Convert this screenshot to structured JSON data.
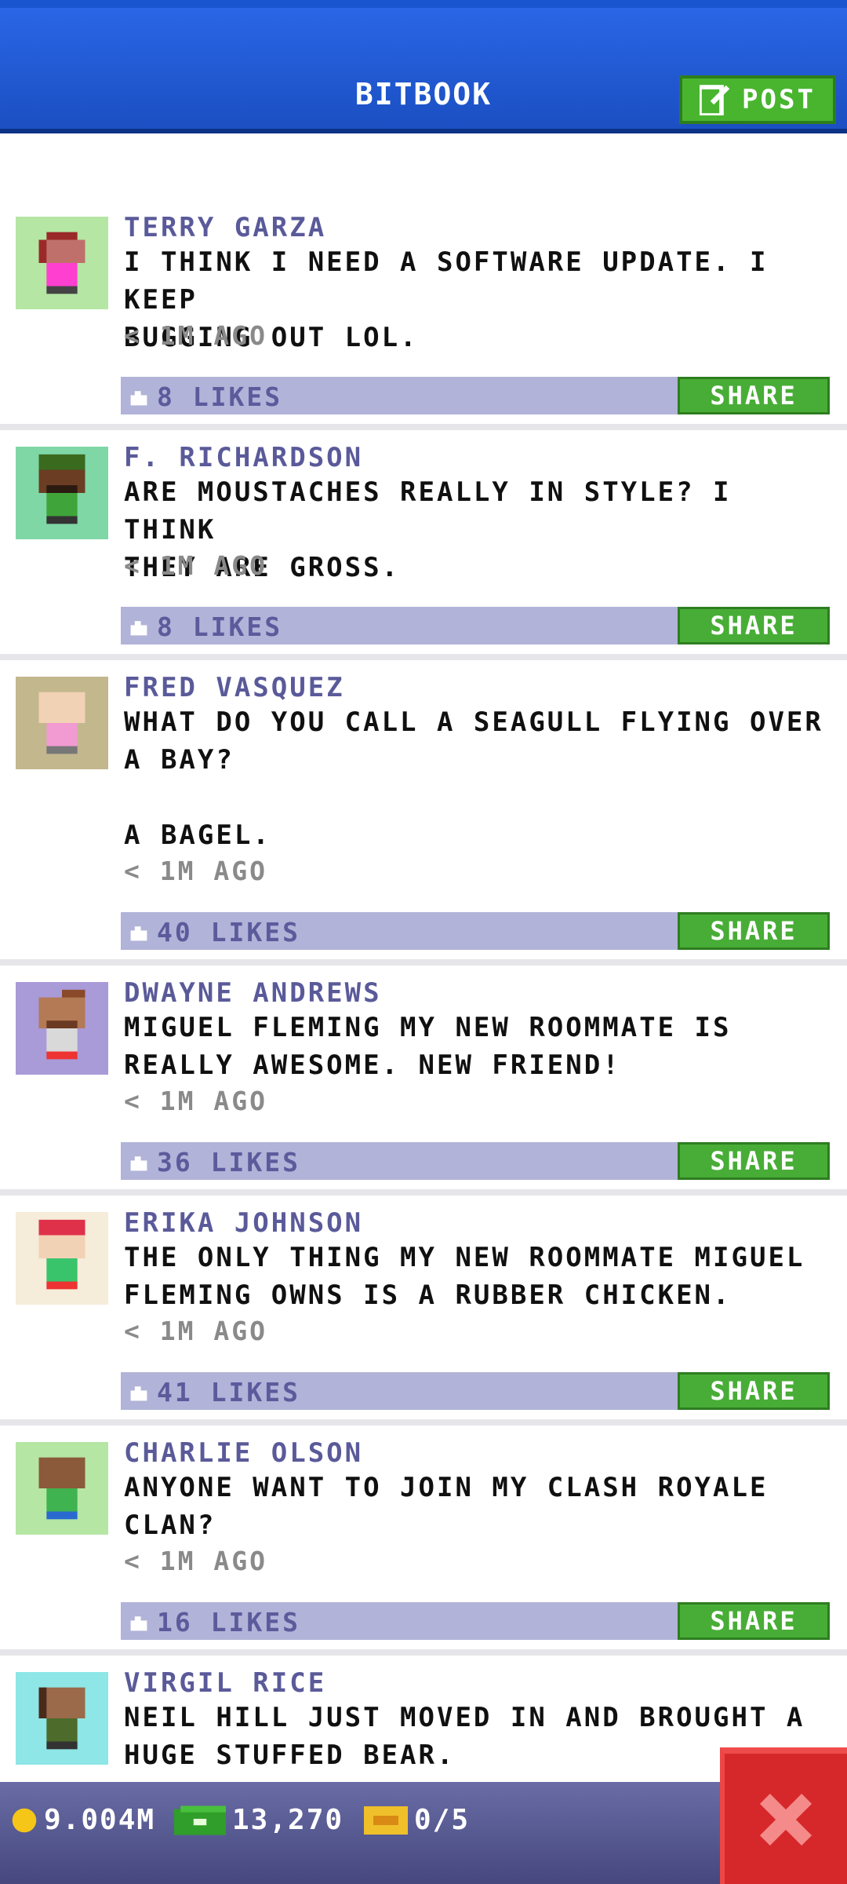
{
  "header": {
    "title": "BITBOOK",
    "post_label": "POST"
  },
  "posts": [
    {
      "name": "TERRY GARZA",
      "text": "I THINK I NEED A SOFTWARE UPDATE. I KEEP\nBUGGING OUT LOL.",
      "time": "< 1M AGO",
      "likes": "8 LIKES",
      "share": "SHARE"
    },
    {
      "name": "F. RICHARDSON",
      "text": "ARE MOUSTACHES REALLY IN STYLE? I THINK\nTHEY ARE GROSS.",
      "time": "< 1M AGO",
      "likes": "8 LIKES",
      "share": "SHARE"
    },
    {
      "name": "FRED VASQUEZ",
      "text": "WHAT DO YOU CALL A SEAGULL FLYING OVER\nA BAY?\n\nA BAGEL.",
      "time": "< 1M AGO",
      "likes": "40 LIKES",
      "share": "SHARE"
    },
    {
      "name": "DWAYNE ANDREWS",
      "text": "MIGUEL FLEMING MY NEW ROOMMATE IS\nREALLY AWESOME. NEW FRIEND!",
      "time": "< 1M AGO",
      "likes": "36 LIKES",
      "share": "SHARE"
    },
    {
      "name": "ERIKA JOHNSON",
      "text": "THE ONLY THING MY NEW ROOMMATE MIGUEL\nFLEMING OWNS IS A RUBBER CHICKEN.",
      "time": "< 1M AGO",
      "likes": "41 LIKES",
      "share": "SHARE"
    },
    {
      "name": "CHARLIE OLSON",
      "text": "ANYONE WANT TO JOIN MY CLASH ROYALE\nCLAN?",
      "time": "< 1M AGO",
      "likes": "16 LIKES",
      "share": "SHARE"
    },
    {
      "name": "VIRGIL RICE",
      "text": "NEIL HILL JUST MOVED IN AND BROUGHT A\nHUGE STUFFED BEAR."
    }
  ],
  "status": {
    "coins": "9.004M",
    "bux": "13,270",
    "tickets": "0/5"
  },
  "colors": {
    "header": "#1b4fc2",
    "share": "#48ad36",
    "likes_bar": "#b1b3d8",
    "close": "#d6282a"
  },
  "icons": {
    "post": "edit-icon",
    "like": "like-icon",
    "coin": "coin-icon",
    "bux": "bux-icon",
    "ticket": "ticket-icon",
    "close": "close-icon"
  }
}
